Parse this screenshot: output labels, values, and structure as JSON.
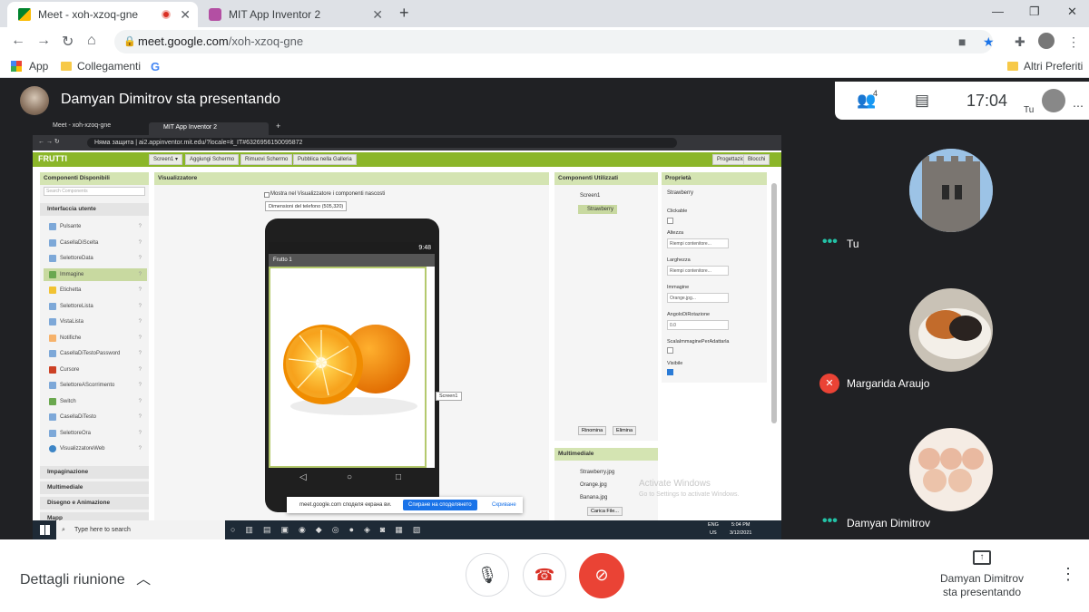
{
  "browser": {
    "tabs": [
      {
        "title": "Meet - xoh-xzoq-gne",
        "active": true
      },
      {
        "title": "MIT App Inventor 2",
        "active": false
      }
    ],
    "url_host": "meet.google.com",
    "url_path": "/xoh-xzoq-gne",
    "bookmarks": [
      "App",
      "Collegamenti",
      "G"
    ],
    "other_bookmarks": "Altri Preferiti"
  },
  "meet": {
    "presenter_title": "Damyan Dimitrov sta presentando",
    "participant_count": "4",
    "clock": "17:04",
    "self_label": "Tu",
    "participants": [
      {
        "name": "Tu",
        "muted": false
      },
      {
        "name": "Margarida Araujo",
        "muted": true
      },
      {
        "name": "Damyan Dimitrov",
        "muted": false
      }
    ],
    "bottom": {
      "details_label": "Dettagli riunione",
      "presenting_label_line1": "Damyan Dimitrov",
      "presenting_label_line2": "sta presentando"
    }
  },
  "shared_screen": {
    "tabs": [
      "Meet - xoh-xzoq-gne",
      "MIT App Inventor 2"
    ],
    "url": "ai2.appinventor.mit.edu/?locale=it_IT#6326956150095872",
    "insecure_label": "Няма защита",
    "app_name": "FRUTTI",
    "toolbar_buttons": [
      "Screen1 ▾",
      "Aggiungi Schermo",
      "Rimuovi Schermo",
      "Pubblica nella Galleria"
    ],
    "right_buttons": [
      "Progettazione",
      "Blocchi"
    ],
    "palette": {
      "header": "Componenti Disponibili",
      "search_placeholder": "Search Components",
      "category": "Interfaccia utente",
      "items": [
        "Pulsante",
        "CasellaDiScelta",
        "SelettoreData",
        "Immagine",
        "Etichetta",
        "SelettoreLista",
        "VistaLista",
        "Notifiche",
        "CasellaDiTestoPassword",
        "Cursore",
        "SelettoreAScorrimento",
        "Switch",
        "CasellaDiTesto",
        "SelettoreOra",
        "VisualizzatoreWeb"
      ],
      "selected_item": "Immagine",
      "more_categories": [
        "Impaginazione",
        "Multimediale",
        "Disegno e Animazione",
        "Mapp"
      ]
    },
    "viewer": {
      "header": "Visualizzatore",
      "hidden_check": "Mostra nel Visualizzatore i componenti nascosti",
      "size_select": "Dimensioni del telefono (505,320)",
      "time": "9:48",
      "screen_title": "Frutto 1",
      "tooltip": "Screen1"
    },
    "components": {
      "header": "Componenti Utilizzati",
      "tree": [
        "Screen1",
        "Strawberry"
      ],
      "rename": "Rinomina",
      "delete": "Elimina"
    },
    "media": {
      "header": "Multimediale",
      "files": [
        "Strawberry.jpg",
        "Orange.jpg",
        "Banana.jpg"
      ],
      "upload": "Carica File..."
    },
    "properties": {
      "header": "Proprietà",
      "component": "Strawberry",
      "clickable_label": "Clickable",
      "height_label": "Altezza",
      "height_value": "Riempi contenitore...",
      "width_label": "Larghezza",
      "width_value": "Riempi contenitore...",
      "picture_label": "Immagine",
      "picture_value": "Orange.jpg...",
      "rotation_label": "AngoloDiRotazione",
      "rotation_value": "0.0",
      "scale_label": "ScalaImmagine​PerAdattarla",
      "visible_label": "Visibile"
    },
    "share_notice": {
      "text": "meet.google.com споделя екрана ви.",
      "stop": "Спиране на споделянето",
      "hide": "Скриване"
    },
    "watermark_line1": "Activate Windows",
    "watermark_line2": "Go to Settings to activate Windows.",
    "taskbar": {
      "search": "Type here to search",
      "lang": "ENG",
      "lang2": "US",
      "time": "5:04 PM",
      "date": "3/12/2021"
    }
  }
}
